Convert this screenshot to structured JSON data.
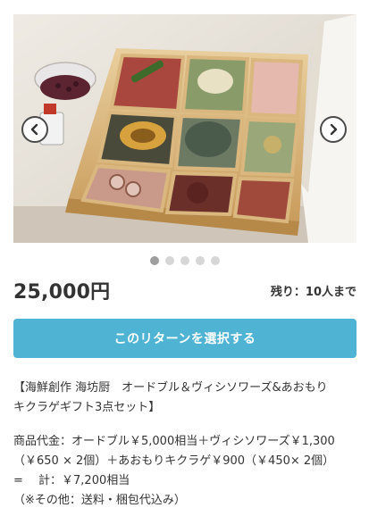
{
  "carousel": {
    "image_alt": "おせち風の木箱に詰められた海鮮料理",
    "prev_icon": "chevron-left-icon",
    "next_icon": "chevron-right-icon",
    "dot_count": 5,
    "active_index": 0
  },
  "reward": {
    "price": "25,000円",
    "remaining": "残り：10人まで",
    "select_label": "このリターンを選択する",
    "title_line1": "【海鮮創作 海坊厨　オードブル＆ヴィシソワーズ&あおもり",
    "title_line2": "キクラゲギフト3点セット】",
    "body_line1": "商品代金：オードブル￥5,000相当＋ヴィシソワーズ￥1,300",
    "body_line2": "（￥650 × 2個）＋あおもりキクラゲ￥900（￥450× 2個）",
    "body_line3": "=　 計：￥7,200相当",
    "body_line4": "（※その他：送料・梱包代込み）"
  },
  "colors": {
    "accent": "#4fb4d3",
    "dot_active": "#9e9e9e",
    "dot_inactive": "#d6d6d6"
  }
}
